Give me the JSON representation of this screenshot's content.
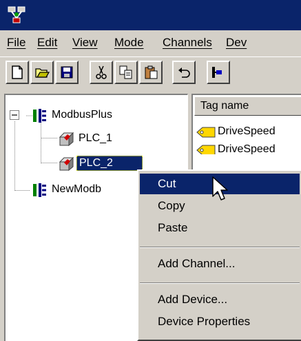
{
  "window": {
    "app_icon": "network-app-icon"
  },
  "menubar": {
    "items": [
      "File",
      "Edit",
      "View",
      "Mode",
      "Channels",
      "Dev"
    ]
  },
  "toolbar": {
    "buttons": [
      "new-document-icon",
      "open-folder-icon",
      "save-icon",
      "cut-scissors-icon",
      "copy-icon",
      "paste-icon",
      "undo-icon",
      "network-add-icon"
    ]
  },
  "tree": {
    "root": "ModbusPlus",
    "children": [
      "PLC_1",
      "PLC_2"
    ],
    "second_root": "NewModb"
  },
  "list": {
    "column_header": "Tag name",
    "rows": [
      "DriveSpeed",
      "DriveSpeed"
    ]
  },
  "context_menu": {
    "items": [
      "Cut",
      "Copy",
      "Paste",
      "Add Channel...",
      "Add Device...",
      "Device Properties"
    ],
    "selected": "Cut"
  },
  "colors": {
    "selection": "#0a246a",
    "face": "#d4d0c8"
  }
}
